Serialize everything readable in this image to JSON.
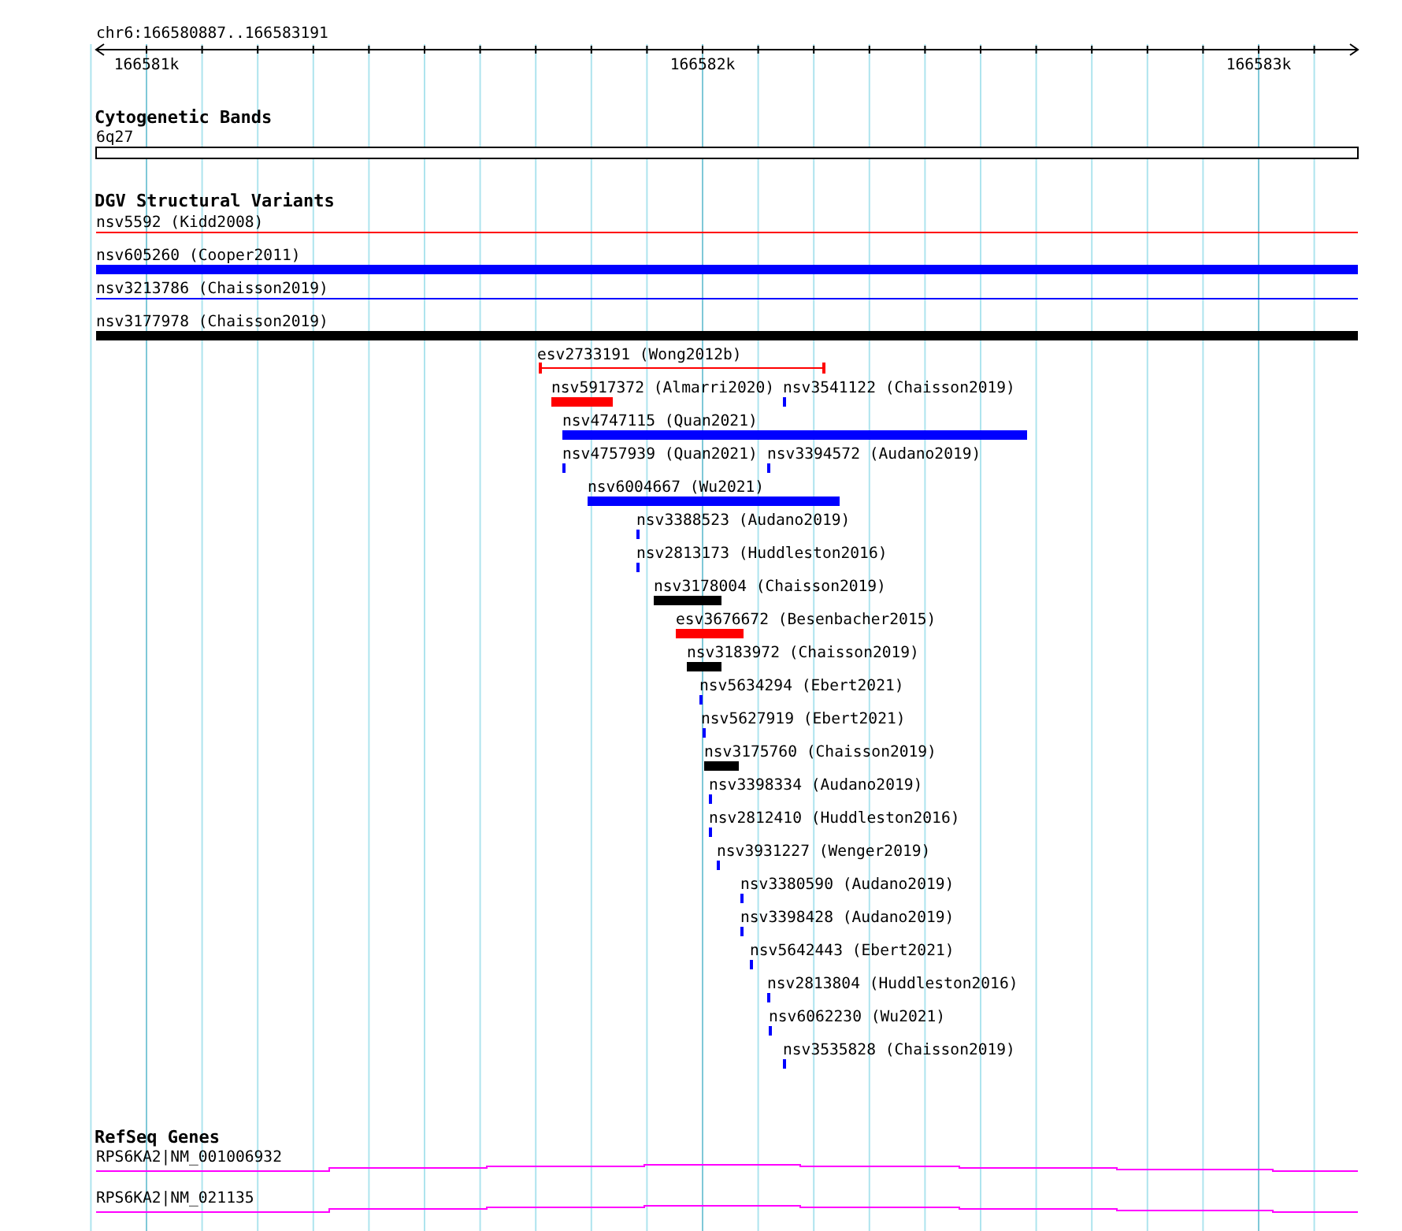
{
  "location": "chr6:166580887..166583191",
  "ruler": {
    "ticks": [
      "166581k",
      "166582k",
      "166583k"
    ]
  },
  "tracks": [
    {
      "title": "Cytogenetic Bands",
      "features": [
        {
          "label": "6q27",
          "kind": "band"
        }
      ]
    },
    {
      "title": "DGV Structural Variants",
      "features": [
        {
          "label": "nsv5592 (Kidd2008)",
          "kind": "line",
          "color": "#ff0000"
        },
        {
          "label": "nsv605260 (Cooper2011)",
          "kind": "bar",
          "color": "#0000ff"
        },
        {
          "label": "nsv3213786 (Chaisson2019)",
          "kind": "line",
          "color": "#0000ff"
        },
        {
          "label": "nsv3177978 (Chaisson2019)",
          "kind": "bar",
          "color": "#000000"
        },
        {
          "label": "esv2733191 (Wong2012b)",
          "kind": "span",
          "color": "#ff0000"
        },
        {
          "label": "nsv5917372 (Almarri2020)",
          "kind": "bar",
          "color": "#ff0000"
        },
        {
          "label": "nsv3541122 (Chaisson2019)",
          "kind": "bar",
          "color": "#0000ff"
        },
        {
          "label": "nsv4747115 (Quan2021)",
          "kind": "bar",
          "color": "#0000ff"
        },
        {
          "label": "nsv4757939 (Quan2021)",
          "kind": "bar",
          "color": "#0000ff"
        },
        {
          "label": "nsv3394572 (Audano2019)",
          "kind": "bar",
          "color": "#0000ff"
        },
        {
          "label": "nsv6004667 (Wu2021)",
          "kind": "bar",
          "color": "#0000ff"
        },
        {
          "label": "nsv3388523 (Audano2019)",
          "kind": "bar",
          "color": "#0000ff"
        },
        {
          "label": "nsv2813173 (Huddleston2016)",
          "kind": "bar",
          "color": "#0000ff"
        },
        {
          "label": "nsv3178004 (Chaisson2019)",
          "kind": "bar",
          "color": "#000000"
        },
        {
          "label": "esv3676672 (Besenbacher2015)",
          "kind": "bar",
          "color": "#ff0000"
        },
        {
          "label": "nsv3183972 (Chaisson2019)",
          "kind": "bar",
          "color": "#000000"
        },
        {
          "label": "nsv5634294 (Ebert2021)",
          "kind": "bar",
          "color": "#0000ff"
        },
        {
          "label": "nsv5627919 (Ebert2021)",
          "kind": "bar",
          "color": "#0000ff"
        },
        {
          "label": "nsv3175760 (Chaisson2019)",
          "kind": "bar",
          "color": "#000000"
        },
        {
          "label": "nsv3398334 (Audano2019)",
          "kind": "bar",
          "color": "#0000ff"
        },
        {
          "label": "nsv2812410 (Huddleston2016)",
          "kind": "bar",
          "color": "#0000ff"
        },
        {
          "label": "nsv3931227 (Wenger2019)",
          "kind": "bar",
          "color": "#0000ff"
        },
        {
          "label": "nsv3380590 (Audano2019)",
          "kind": "bar",
          "color": "#0000ff"
        },
        {
          "label": "nsv3398428 (Audano2019)",
          "kind": "bar",
          "color": "#0000ff"
        },
        {
          "label": "nsv5642443 (Ebert2021)",
          "kind": "bar",
          "color": "#0000ff"
        },
        {
          "label": "nsv2813804 (Huddleston2016)",
          "kind": "bar",
          "color": "#0000ff"
        },
        {
          "label": "nsv6062230 (Wu2021)",
          "kind": "bar",
          "color": "#0000ff"
        },
        {
          "label": "nsv3535828 (Chaisson2019)",
          "kind": "bar",
          "color": "#0000ff"
        }
      ]
    },
    {
      "title": "RefSeq Genes",
      "features": [
        {
          "label": "RPS6KA2|NM_001006932",
          "kind": "gene"
        },
        {
          "label": "RPS6KA2|NM_021135",
          "kind": "gene"
        }
      ]
    }
  ]
}
